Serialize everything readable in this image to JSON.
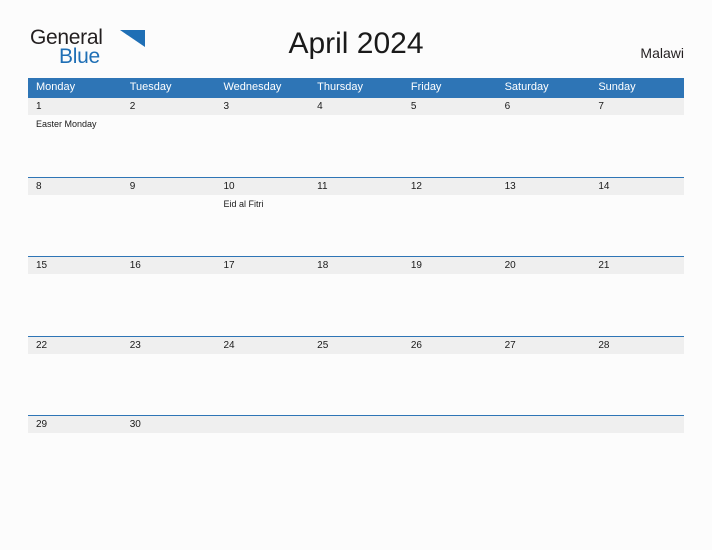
{
  "logo": {
    "word_one": "General",
    "word_two": "Blue",
    "flag_icon": "flag-triangle-icon",
    "color_dark": "#231f20",
    "color_blue": "#1f6fb5"
  },
  "header": {
    "title": "April 2024",
    "country": "Malawi"
  },
  "theme": {
    "header_blue": "#2e75b6",
    "band_gray": "#efefef",
    "page_background": "#fcfcfc",
    "text": "#1a1a1a"
  },
  "calendar": {
    "weekdays": [
      "Monday",
      "Tuesday",
      "Wednesday",
      "Thursday",
      "Friday",
      "Saturday",
      "Sunday"
    ],
    "weeks": [
      [
        {
          "day": "1",
          "event": "Easter Monday"
        },
        {
          "day": "2",
          "event": ""
        },
        {
          "day": "3",
          "event": ""
        },
        {
          "day": "4",
          "event": ""
        },
        {
          "day": "5",
          "event": ""
        },
        {
          "day": "6",
          "event": ""
        },
        {
          "day": "7",
          "event": ""
        }
      ],
      [
        {
          "day": "8",
          "event": ""
        },
        {
          "day": "9",
          "event": ""
        },
        {
          "day": "10",
          "event": "Eid al Fitri"
        },
        {
          "day": "11",
          "event": ""
        },
        {
          "day": "12",
          "event": ""
        },
        {
          "day": "13",
          "event": ""
        },
        {
          "day": "14",
          "event": ""
        }
      ],
      [
        {
          "day": "15",
          "event": ""
        },
        {
          "day": "16",
          "event": ""
        },
        {
          "day": "17",
          "event": ""
        },
        {
          "day": "18",
          "event": ""
        },
        {
          "day": "19",
          "event": ""
        },
        {
          "day": "20",
          "event": ""
        },
        {
          "day": "21",
          "event": ""
        }
      ],
      [
        {
          "day": "22",
          "event": ""
        },
        {
          "day": "23",
          "event": ""
        },
        {
          "day": "24",
          "event": ""
        },
        {
          "day": "25",
          "event": ""
        },
        {
          "day": "26",
          "event": ""
        },
        {
          "day": "27",
          "event": ""
        },
        {
          "day": "28",
          "event": ""
        }
      ],
      [
        {
          "day": "29",
          "event": ""
        },
        {
          "day": "30",
          "event": ""
        },
        {
          "day": "",
          "event": ""
        },
        {
          "day": "",
          "event": ""
        },
        {
          "day": "",
          "event": ""
        },
        {
          "day": "",
          "event": ""
        },
        {
          "day": "",
          "event": ""
        }
      ]
    ]
  }
}
